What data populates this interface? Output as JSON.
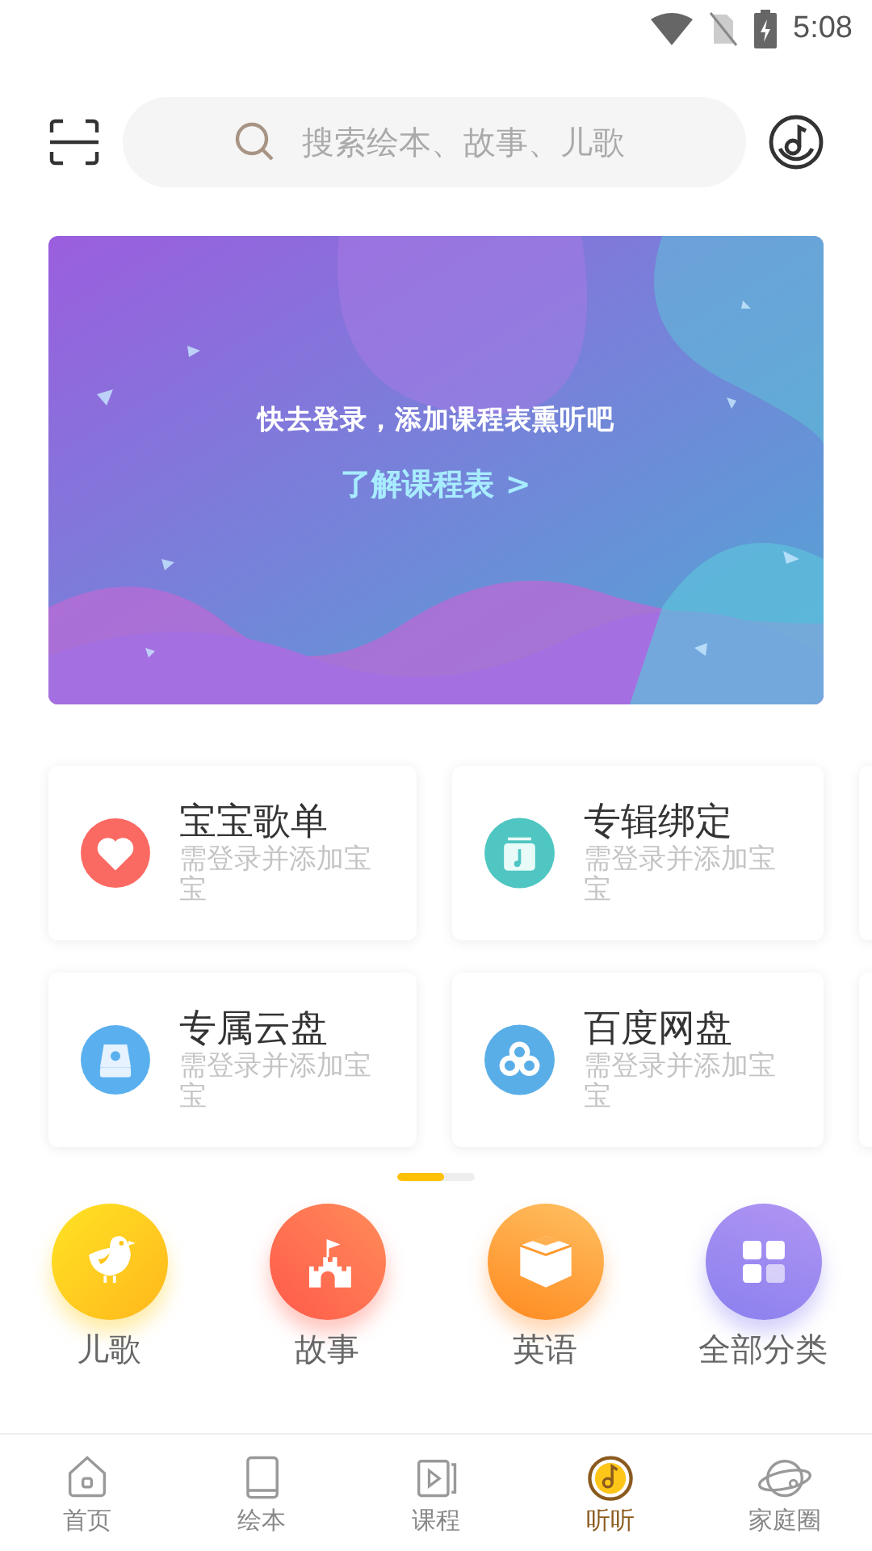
{
  "status_bar": {
    "time": "5:08"
  },
  "search": {
    "placeholder": "搜索绘本、故事、儿歌"
  },
  "banner": {
    "message": "快去登录，添加课程表熏听吧",
    "link": "了解课程表 >"
  },
  "cards": [
    {
      "title": "宝宝歌单",
      "subtitle": "需登录并添加宝宝",
      "kind": "heart",
      "color": "#fb6a62"
    },
    {
      "title": "专辑绑定",
      "subtitle": "需登录并添加宝宝",
      "kind": "album",
      "color": "#4fc6c2"
    },
    {
      "title": "专属云盘",
      "subtitle": "需登录并添加宝宝",
      "kind": "drive",
      "color": "#5ab0ef"
    },
    {
      "title": "百度网盘",
      "subtitle": "需登录并添加宝宝",
      "kind": "cloud",
      "color": "#5aaee8"
    }
  ],
  "pager": {
    "level": 0.6
  },
  "categories": [
    {
      "label": "儿歌",
      "kind": "bird"
    },
    {
      "label": "故事",
      "kind": "castle"
    },
    {
      "label": "英语",
      "kind": "cube"
    },
    {
      "label": "全部分类",
      "kind": "grid"
    }
  ],
  "nav": [
    {
      "label": "首页",
      "kind": "home",
      "selected": false
    },
    {
      "label": "绘本",
      "kind": "book",
      "selected": false
    },
    {
      "label": "课程",
      "kind": "video",
      "selected": false
    },
    {
      "label": "听听",
      "kind": "music",
      "selected": true
    },
    {
      "label": "家庭圈",
      "kind": "planet",
      "selected": false
    }
  ]
}
